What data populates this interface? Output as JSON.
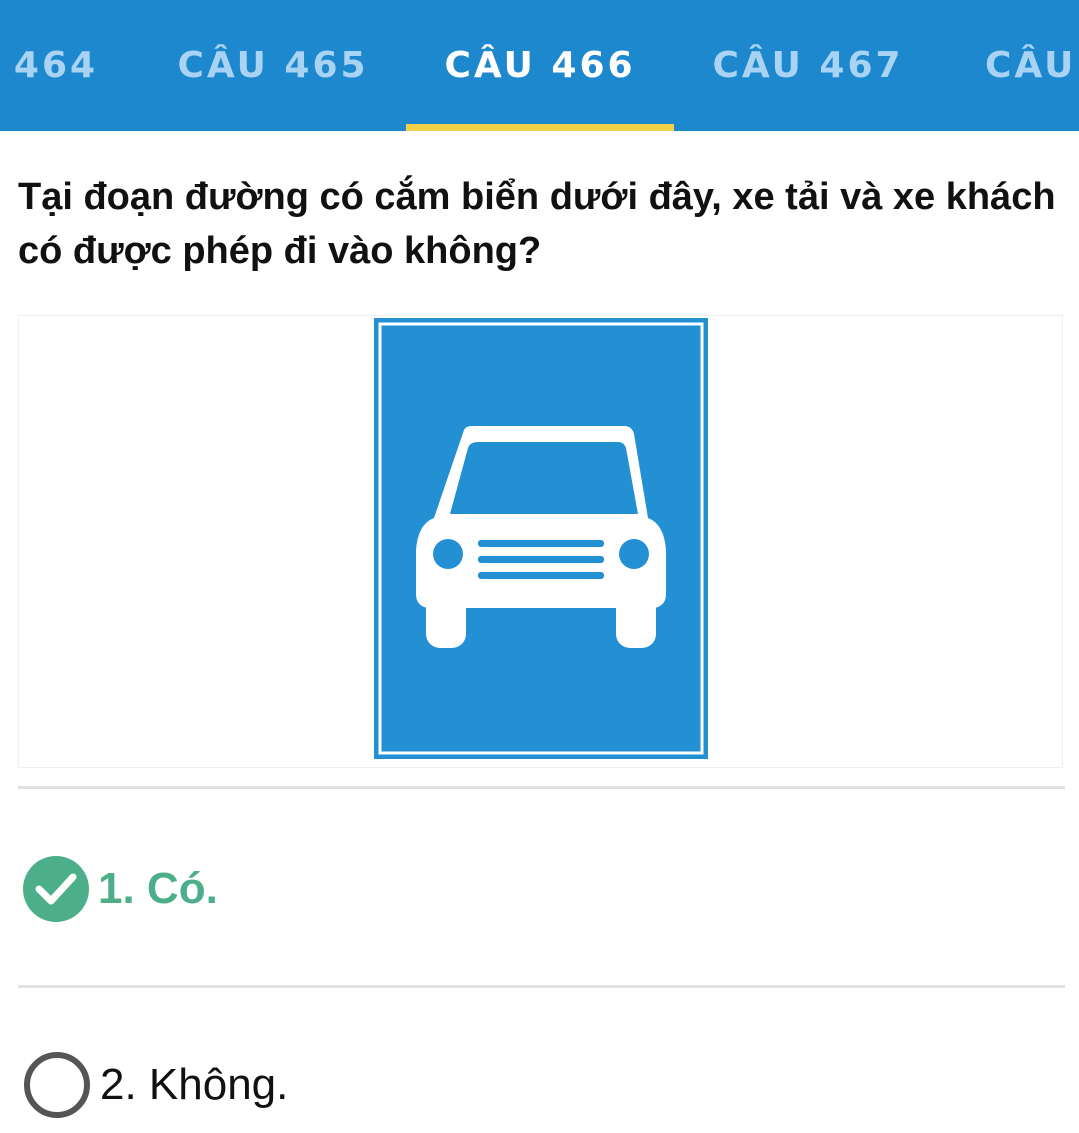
{
  "tabs": [
    {
      "label": "464",
      "active": false
    },
    {
      "label": "CÂU 465",
      "active": false
    },
    {
      "label": "CÂU 466",
      "active": true
    },
    {
      "label": "CÂU 467",
      "active": false
    },
    {
      "label": "CÂU",
      "active": false
    }
  ],
  "question": {
    "text": "Tại đoạn đường có cắm biển dưới đây, xe tải và xe khách có được phép đi vào không?"
  },
  "sign": {
    "icon": "car-road-sign-icon",
    "background_color": "#2390d4",
    "symbol_color": "#ffffff"
  },
  "answers": [
    {
      "label": "1. Có.",
      "correct": true,
      "icon": "check-circle-icon"
    },
    {
      "label": "2. Không.",
      "correct": false,
      "icon": "empty-radio-circle-icon"
    }
  ],
  "colors": {
    "header": "#1e88cf",
    "active_indicator": "#f4d048",
    "inactive_tab_text": "#a8d3f2",
    "correct_answer": "#4caf8a"
  }
}
